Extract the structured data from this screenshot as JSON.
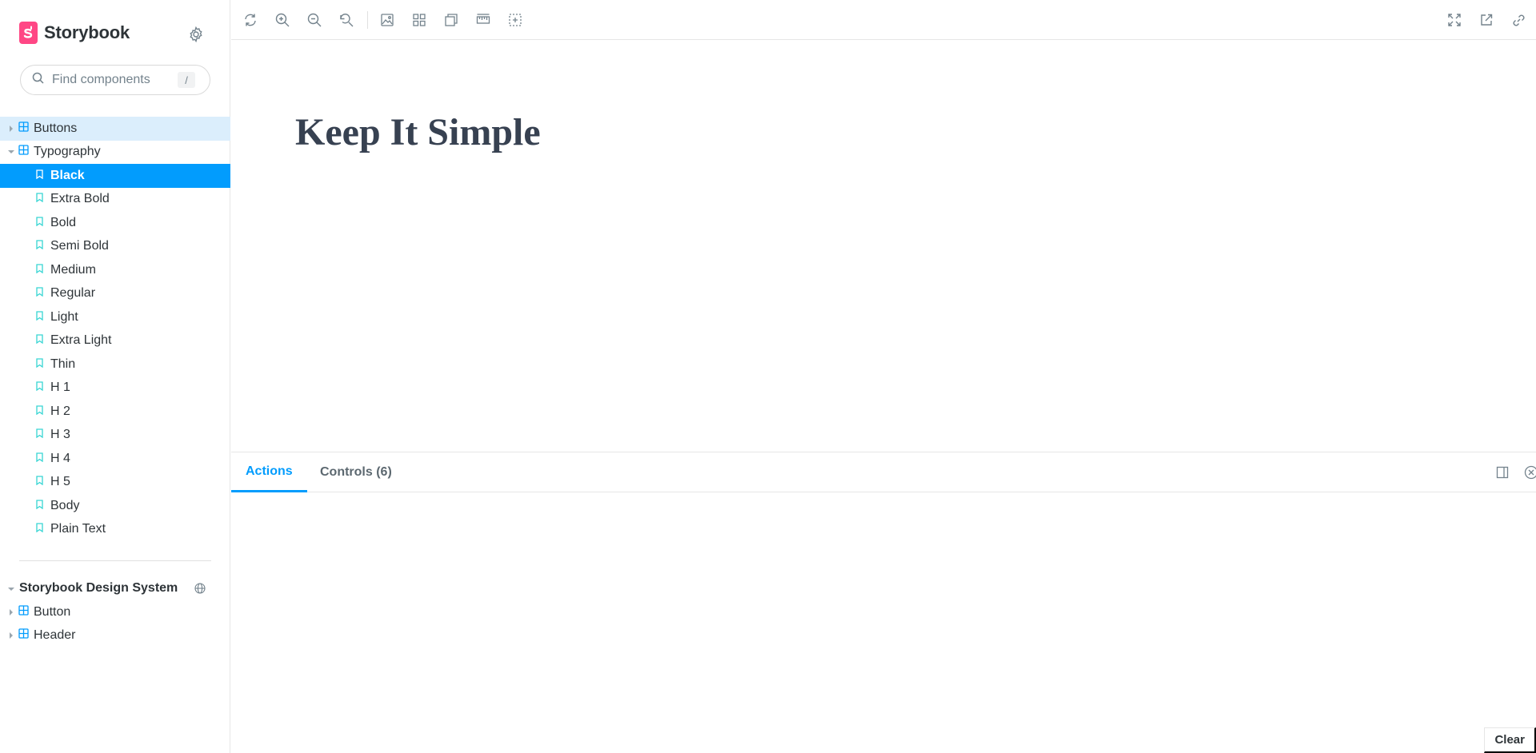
{
  "brand": {
    "name": "Storybook",
    "accent": "#ff4785"
  },
  "search": {
    "placeholder": "Find components",
    "shortcut": "/"
  },
  "tree": {
    "components": [
      {
        "label": "Buttons",
        "expanded": false
      },
      {
        "label": "Typography",
        "expanded": true
      }
    ],
    "stories": [
      {
        "label": "Black",
        "selected": true
      },
      {
        "label": "Extra Bold"
      },
      {
        "label": "Bold"
      },
      {
        "label": "Semi Bold"
      },
      {
        "label": "Medium"
      },
      {
        "label": "Regular"
      },
      {
        "label": "Light"
      },
      {
        "label": "Extra Light"
      },
      {
        "label": "Thin"
      },
      {
        "label": "H 1"
      },
      {
        "label": "H 2"
      },
      {
        "label": "H 3"
      },
      {
        "label": "H 4"
      },
      {
        "label": "H 5"
      },
      {
        "label": "Body"
      },
      {
        "label": "Plain Text"
      }
    ]
  },
  "ref": {
    "title": "Storybook Design System",
    "items": [
      {
        "label": "Button"
      },
      {
        "label": "Header"
      }
    ]
  },
  "preview": {
    "heading": "Keep It Simple"
  },
  "panel": {
    "tabs": [
      {
        "label": "Actions",
        "active": true
      },
      {
        "label": "Controls (6)"
      }
    ],
    "clear_label": "Clear"
  },
  "colors": {
    "selected": "#029cfd",
    "hover": "#dbeefc",
    "story_icon": "#37d5d3",
    "component_icon": "#029cfd"
  }
}
